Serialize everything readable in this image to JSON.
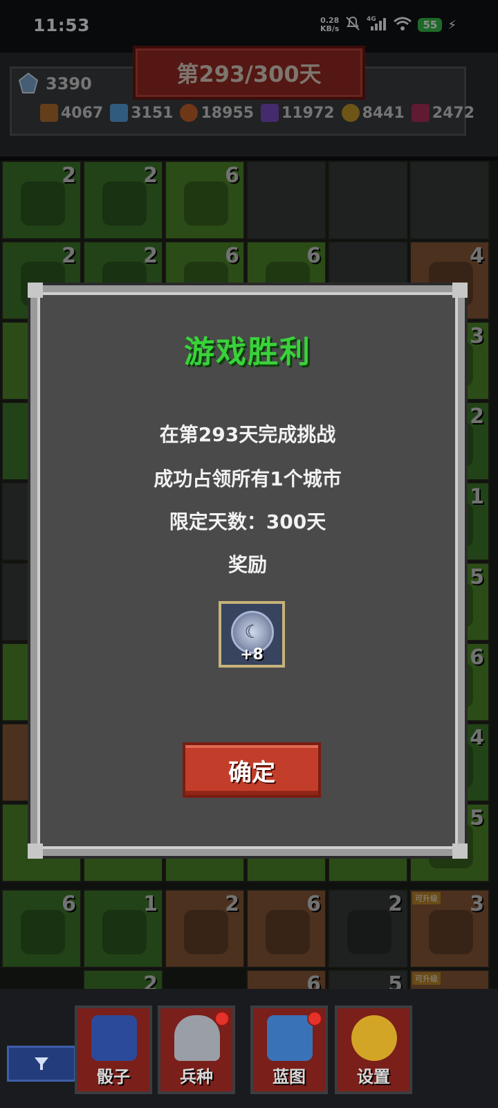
{
  "status_bar": {
    "time": "11:53",
    "net_speed_value": "0.28",
    "net_speed_unit": "KB/s",
    "network": "4G",
    "battery": "55"
  },
  "hud": {
    "day_banner": "第293/300天",
    "gem_count": "3390",
    "resources": [
      {
        "icon": "wood-icon",
        "color": "#b5712f",
        "value": "4067"
      },
      {
        "icon": "iron-icon",
        "color": "#5aa6e6",
        "value": "3151"
      },
      {
        "icon": "meat-icon",
        "color": "#c8652a",
        "value": "18955"
      },
      {
        "icon": "crystal-icon",
        "color": "#7e4fc6",
        "value": "11972"
      },
      {
        "icon": "coin-icon",
        "color": "#c79a2a",
        "value": "8441"
      },
      {
        "icon": "ruby-icon",
        "color": "#b0305a",
        "value": "2472"
      }
    ]
  },
  "board": {
    "tiles": [
      {
        "num": "2"
      },
      {
        "num": "2"
      },
      {
        "num": "6"
      },
      {
        "num": "2"
      },
      {
        "num": "2"
      },
      {
        "num": "6"
      },
      {
        "num": "6"
      },
      {
        "num": "4"
      },
      {
        "num": "3"
      },
      {
        "num": "2"
      },
      {
        "num": "1"
      },
      {
        "num": "5"
      },
      {
        "num": "6"
      },
      {
        "num": "4"
      },
      {
        "num": "5"
      },
      {
        "num": "6"
      },
      {
        "num": "1"
      },
      {
        "num": "2"
      },
      {
        "num": "6"
      },
      {
        "num": "2"
      },
      {
        "num": "3"
      },
      {
        "num": "2"
      },
      {
        "num": "6"
      },
      {
        "num": "5"
      },
      {
        "num": "5"
      }
    ],
    "upgrade_tag": "可升级"
  },
  "modal": {
    "title": "游戏胜利",
    "line1": "在第293天完成挑战",
    "line2": "成功占领所有1个城市",
    "line3": "限定天数：300天",
    "reward_label": "奖励",
    "reward_count": "+8",
    "confirm": "确定"
  },
  "nav": {
    "items": [
      {
        "label": "骰子",
        "icon": "dice-icon"
      },
      {
        "label": "兵种",
        "icon": "helmet-icon"
      },
      {
        "label": "蓝图",
        "icon": "blueprint-icon"
      },
      {
        "label": "设置",
        "icon": "gear-icon"
      }
    ]
  }
}
